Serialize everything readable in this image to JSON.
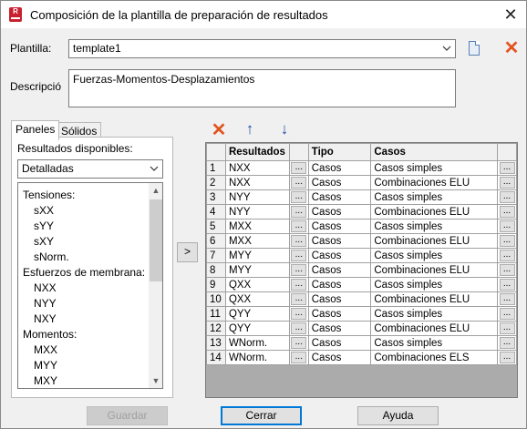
{
  "window": {
    "title": "Composición de la plantilla de preparación de resultados",
    "app_icon_letter": "R",
    "close_glyph": "✕"
  },
  "form": {
    "template_label": "Plantilla:",
    "template_value": "template1",
    "description_label": "Descripció",
    "description_value": "Fuerzas-Momentos-Desplazamientos"
  },
  "tabs": [
    {
      "label": "Paneles",
      "active": true
    },
    {
      "label": "Sólidos",
      "active": false
    }
  ],
  "left_panel": {
    "available_label": "Resultados disponibles:",
    "detail_select": "Detalladas",
    "items": [
      {
        "label": "Tensiones:",
        "indent": false
      },
      {
        "label": "sXX",
        "indent": true
      },
      {
        "label": "sYY",
        "indent": true
      },
      {
        "label": "sXY",
        "indent": true
      },
      {
        "label": "sNorm.",
        "indent": true
      },
      {
        "label": "Esfuerzos de membrana:",
        "indent": false
      },
      {
        "label": "NXX",
        "indent": true
      },
      {
        "label": "NYY",
        "indent": true
      },
      {
        "label": "NXY",
        "indent": true
      },
      {
        "label": "Momentos:",
        "indent": false
      },
      {
        "label": "MXX",
        "indent": true
      },
      {
        "label": "MYY",
        "indent": true
      },
      {
        "label": "MXY",
        "indent": true
      }
    ]
  },
  "add_button": ">",
  "table": {
    "headers": [
      "",
      "Resultados",
      "",
      "Tipo",
      "Casos",
      ""
    ],
    "dots": "...",
    "rows": [
      {
        "n": "1",
        "res": "NXX",
        "tipo": "Casos",
        "casos": "Casos simples"
      },
      {
        "n": "2",
        "res": "NXX",
        "tipo": "Casos",
        "casos": "Combinaciones ELU"
      },
      {
        "n": "3",
        "res": "NYY",
        "tipo": "Casos",
        "casos": "Casos simples"
      },
      {
        "n": "4",
        "res": "NYY",
        "tipo": "Casos",
        "casos": "Combinaciones ELU"
      },
      {
        "n": "5",
        "res": "MXX",
        "tipo": "Casos",
        "casos": "Casos simples"
      },
      {
        "n": "6",
        "res": "MXX",
        "tipo": "Casos",
        "casos": "Combinaciones ELU"
      },
      {
        "n": "7",
        "res": "MYY",
        "tipo": "Casos",
        "casos": "Casos simples"
      },
      {
        "n": "8",
        "res": "MYY",
        "tipo": "Casos",
        "casos": "Combinaciones ELU"
      },
      {
        "n": "9",
        "res": "QXX",
        "tipo": "Casos",
        "casos": "Casos simples"
      },
      {
        "n": "10",
        "res": "QXX",
        "tipo": "Casos",
        "casos": "Combinaciones ELU"
      },
      {
        "n": "11",
        "res": "QYY",
        "tipo": "Casos",
        "casos": "Casos simples"
      },
      {
        "n": "12",
        "res": "QYY",
        "tipo": "Casos",
        "casos": "Combinaciones ELU"
      },
      {
        "n": "13",
        "res": "WNorm.",
        "tipo": "Casos",
        "casos": "Casos simples"
      },
      {
        "n": "14",
        "res": "WNorm.",
        "tipo": "Casos",
        "casos": "Combinaciones ELS"
      }
    ]
  },
  "toolbar": {
    "delete_icon": "✕",
    "up_icon": "↑",
    "down_icon": "↓"
  },
  "buttons": {
    "save": "Guardar",
    "close": "Cerrar",
    "help": "Ayuda"
  },
  "colors": {
    "accent_red": "#e2541f",
    "arrow_blue": "#1f4e9e",
    "default_border": "#0078d7"
  }
}
